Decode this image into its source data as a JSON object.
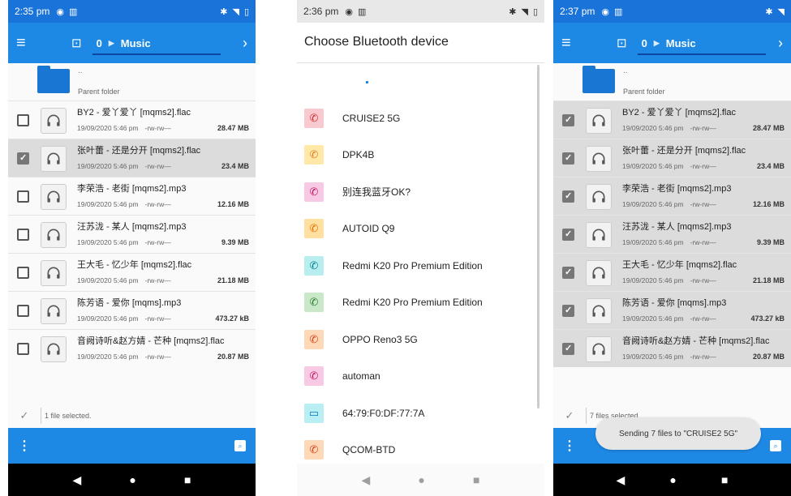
{
  "colors": {
    "accent": "#1e88e5",
    "status": "#1a73d9"
  },
  "screen1": {
    "time": "2:35 pm",
    "breadcrumb_root": "0",
    "breadcrumb_folder": "Music",
    "parent_dots": "..",
    "parent_label": "Parent folder",
    "status_text": "1 file selected.",
    "files": [
      {
        "name": "BY2 - 爱丫爱丫 [mqms2].flac",
        "date": "19/09/2020 5:46 pm",
        "perm": "-rw-rw—",
        "size": "28.47 MB",
        "selected": false
      },
      {
        "name": "张叶蕾 - 还是分开 [mqms2].flac",
        "date": "19/09/2020 5:46 pm",
        "perm": "-rw-rw—",
        "size": "23.4 MB",
        "selected": true
      },
      {
        "name": "李荣浩 - 老街 [mqms2].mp3",
        "date": "19/09/2020 5:46 pm",
        "perm": "-rw-rw—",
        "size": "12.16 MB",
        "selected": false
      },
      {
        "name": "汪苏泷 - 某人 [mqms2].mp3",
        "date": "19/09/2020 5:46 pm",
        "perm": "-rw-rw—",
        "size": "9.39 MB",
        "selected": false
      },
      {
        "name": "王大毛 - 忆少年 [mqms2].flac",
        "date": "19/09/2020 5:46 pm",
        "perm": "-rw-rw—",
        "size": "21.18 MB",
        "selected": false
      },
      {
        "name": "陈芳语 - 爱你 [mqms].mp3",
        "date": "19/09/2020 5:46 pm",
        "perm": "-rw-rw—",
        "size": "473.27 kB",
        "selected": false
      },
      {
        "name": "音阙诗听&赵方婧 - 芒种 [mqms2].flac",
        "date": "19/09/2020 5:46 pm",
        "perm": "-rw-rw—",
        "size": "20.87 MB",
        "selected": false
      }
    ]
  },
  "screen2": {
    "time": "2:36 pm",
    "title": "Choose Bluetooth device",
    "devices": [
      {
        "name": "CRUISE2 5G",
        "icon": "phone-icon",
        "bg": "#f8c9cf",
        "fg": "#d32f2f"
      },
      {
        "name": "DPK4B",
        "icon": "phone-icon",
        "bg": "#ffe8a8",
        "fg": "#e67e22"
      },
      {
        "name": "别连我蓝牙OK?",
        "icon": "phone-icon",
        "bg": "#f8c9e4",
        "fg": "#c2185b"
      },
      {
        "name": "AUTOID Q9",
        "icon": "phone-icon",
        "bg": "#ffe0a0",
        "fg": "#ef6c00"
      },
      {
        "name": "Redmi K20 Pro Premium Edition",
        "icon": "phone-icon",
        "bg": "#b8eef0",
        "fg": "#00838f"
      },
      {
        "name": "Redmi K20 Pro Premium Edition",
        "icon": "phone-icon",
        "bg": "#c8e8c8",
        "fg": "#2e7d32"
      },
      {
        "name": "OPPO Reno3 5G",
        "icon": "phone-icon",
        "bg": "#ffd8b8",
        "fg": "#d84315"
      },
      {
        "name": "automan",
        "icon": "phone-icon",
        "bg": "#f8c9e4",
        "fg": "#c2185b"
      },
      {
        "name": "64:79:F0:DF:77:7A",
        "icon": "laptop-icon",
        "bg": "#b8eef4",
        "fg": "#0277bd"
      },
      {
        "name": "QCOM-BTD",
        "icon": "phone-icon",
        "bg": "#ffd8b8",
        "fg": "#d84315"
      }
    ]
  },
  "screen3": {
    "time": "2:37 pm",
    "breadcrumb_root": "0",
    "breadcrumb_folder": "Music",
    "parent_dots": "..",
    "parent_label": "Parent folder",
    "status_text": "7 files selected",
    "toast": "Sending 7 files to \"CRUISE2 5G\"",
    "files": [
      {
        "name": "BY2 - 爱丫爱丫 [mqms2].flac",
        "date": "19/09/2020 5:46 pm",
        "perm": "-rw-rw—",
        "size": "28.47 MB",
        "selected": true
      },
      {
        "name": "张叶蕾 - 还是分开 [mqms2].flac",
        "date": "19/09/2020 5:46 pm",
        "perm": "-rw-rw—",
        "size": "23.4 MB",
        "selected": true
      },
      {
        "name": "李荣浩 - 老街 [mqms2].mp3",
        "date": "19/09/2020 5:46 pm",
        "perm": "-rw-rw—",
        "size": "12.16 MB",
        "selected": true
      },
      {
        "name": "汪苏泷 - 某人 [mqms2].mp3",
        "date": "19/09/2020 5:46 pm",
        "perm": "-rw-rw—",
        "size": "9.39 MB",
        "selected": true
      },
      {
        "name": "王大毛 - 忆少年 [mqms2].flac",
        "date": "19/09/2020 5:46 pm",
        "perm": "-rw-rw—",
        "size": "21.18 MB",
        "selected": true
      },
      {
        "name": "陈芳语 - 爱你 [mqms].mp3",
        "date": "19/09/2020 5:46 pm",
        "perm": "-rw-rw—",
        "size": "473.27 kB",
        "selected": true
      },
      {
        "name": "音阙诗听&赵方婧 - 芒种 [mqms2].flac",
        "date": "19/09/2020 5:46 pm",
        "perm": "-rw-rw—",
        "size": "20.87 MB",
        "selected": true
      }
    ]
  }
}
